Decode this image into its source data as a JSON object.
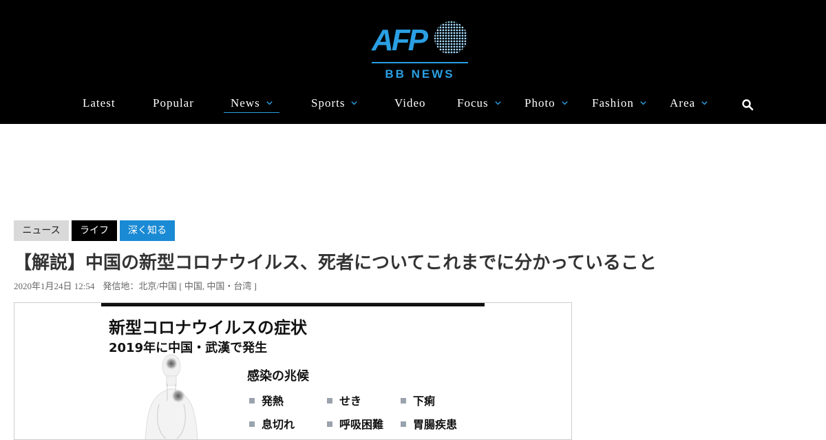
{
  "brand": {
    "logo_text": "AFP",
    "sub_text": "BB NEWS"
  },
  "nav": {
    "items": [
      {
        "label": "Latest",
        "has_dropdown": false
      },
      {
        "label": "Popular",
        "has_dropdown": false
      },
      {
        "label": "News",
        "has_dropdown": true,
        "active": true
      },
      {
        "label": "Sports",
        "has_dropdown": true
      },
      {
        "label": "Video",
        "has_dropdown": false
      },
      {
        "label": "Focus",
        "has_dropdown": true
      },
      {
        "label": "Photo",
        "has_dropdown": true
      },
      {
        "label": "Fashion",
        "has_dropdown": true
      },
      {
        "label": "Area",
        "has_dropdown": true
      }
    ],
    "search_icon": "search-icon"
  },
  "tags": [
    {
      "label": "ニュース"
    },
    {
      "label": "ライフ"
    },
    {
      "label": "深く知る"
    }
  ],
  "article": {
    "headline": "【解説】中国の新型コロナウイルス、死者についてこれまでに分かっていること",
    "date": "2020年1月24日 12:54",
    "location": "発信地：北京/中国 [ 中国, 中国・台湾 ]"
  },
  "infographic": {
    "title": "新型コロナウイルスの症状",
    "subtitle": "2019年に中国・武漢で発生",
    "signs_heading": "感染の兆候",
    "symptoms": [
      "発熱",
      "せき",
      "下痢",
      "息切れ",
      "呼吸困難",
      "胃腸疾患"
    ]
  },
  "colors": {
    "accent": "#2a9fe3",
    "header_bg": "#000000",
    "tag_news_bg": "#d9d9d9",
    "tag_life_bg": "#000000",
    "tag_deep_bg": "#1a8ad4"
  }
}
